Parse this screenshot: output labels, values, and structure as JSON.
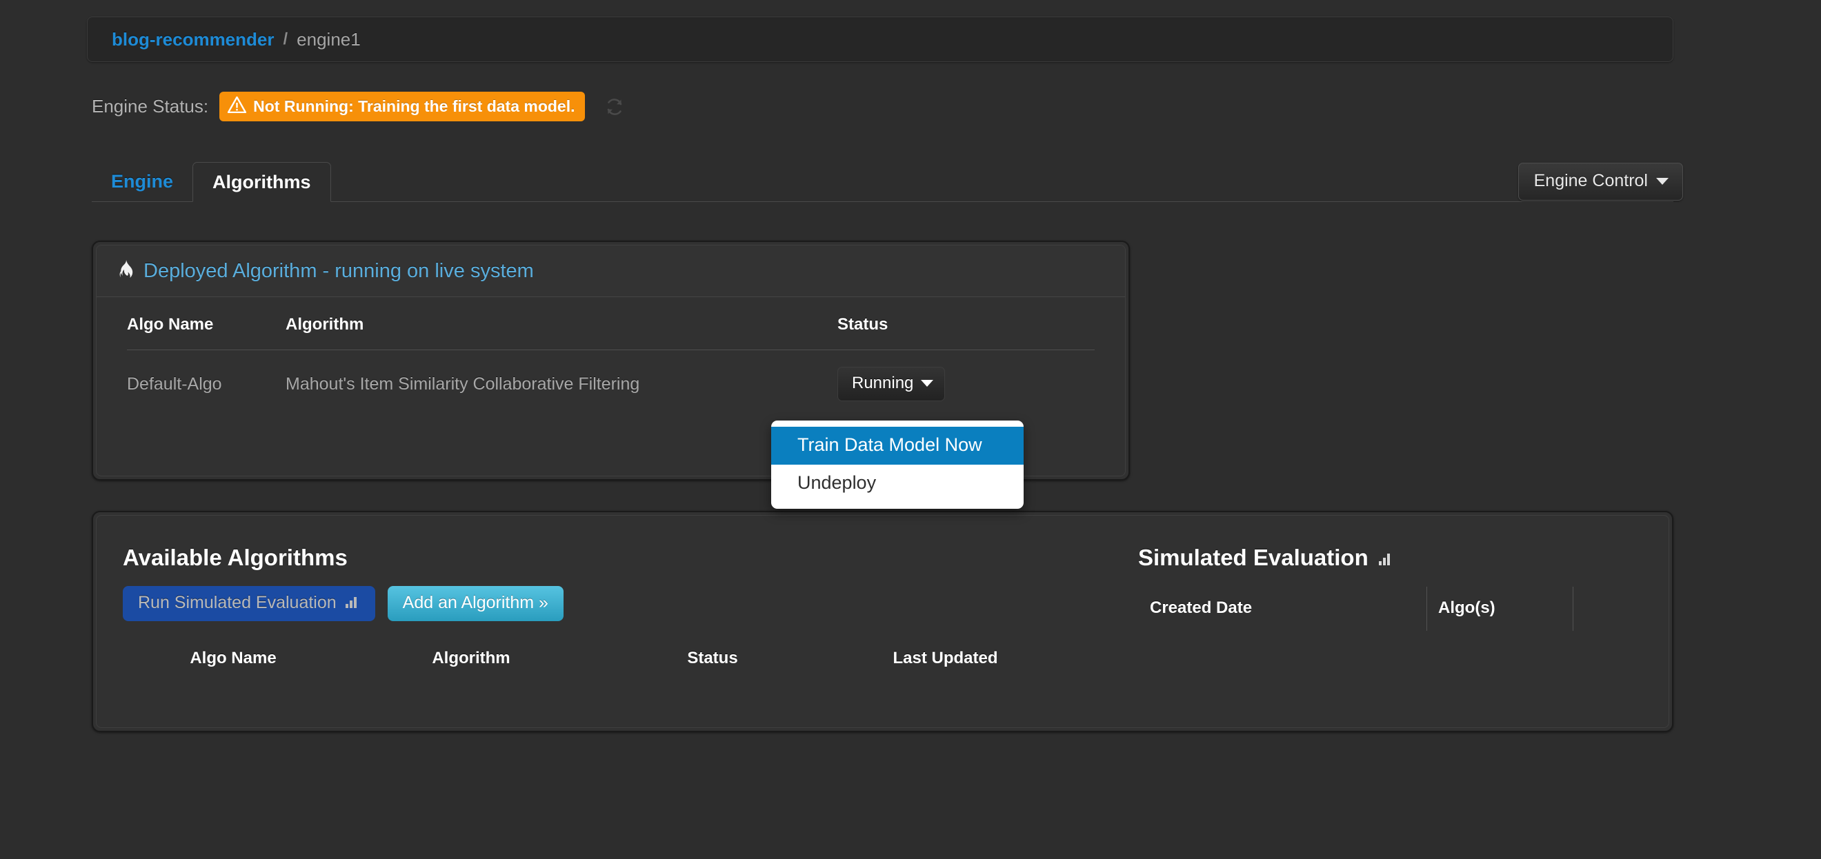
{
  "breadcrumb": {
    "root": "blog-recommender",
    "separator": "/",
    "current": "engine1"
  },
  "status": {
    "label": "Engine Status:",
    "badge_text": "Not Running: Training the first data model.",
    "badge_color": "#f79009",
    "warn_icon": "warning-triangle-icon",
    "refresh_icon": "refresh-icon"
  },
  "tabs": [
    {
      "label": "Engine",
      "active": false
    },
    {
      "label": "Algorithms",
      "active": true
    }
  ],
  "engine_control": {
    "label": "Engine Control",
    "caret_icon": "chevron-down-icon"
  },
  "deployed": {
    "icon": "fire-icon",
    "title_strong": "Deployed Algorithm",
    "title_rest": " - running on live system",
    "title_color": "#5aaedd",
    "columns": [
      "Algo Name",
      "Algorithm",
      "Status"
    ],
    "rows": [
      {
        "algo_name": "Default-Algo",
        "algorithm": "Mahout's Item Similarity Collaborative Filtering",
        "status": "Running"
      }
    ]
  },
  "status_dropdown": {
    "open": true,
    "items": [
      {
        "label": "Train Data Model Now",
        "selected": true
      },
      {
        "label": "Undeploy",
        "selected": false
      }
    ],
    "highlight_color": "#0a7fbf"
  },
  "available": {
    "title": "Available Algorithms",
    "run_eval_button": "Run Simulated Evaluation",
    "run_eval_icon": "bar-chart-icon",
    "add_algo_button": "Add an Algorithm »",
    "columns": [
      "Algo Name",
      "Algorithm",
      "Status",
      "Last Updated"
    ],
    "rows": []
  },
  "simulated_evaluation": {
    "title": "Simulated Evaluation",
    "icon": "bar-chart-icon",
    "columns": [
      "Created Date",
      "Algo(s)",
      ""
    ],
    "rows": []
  }
}
